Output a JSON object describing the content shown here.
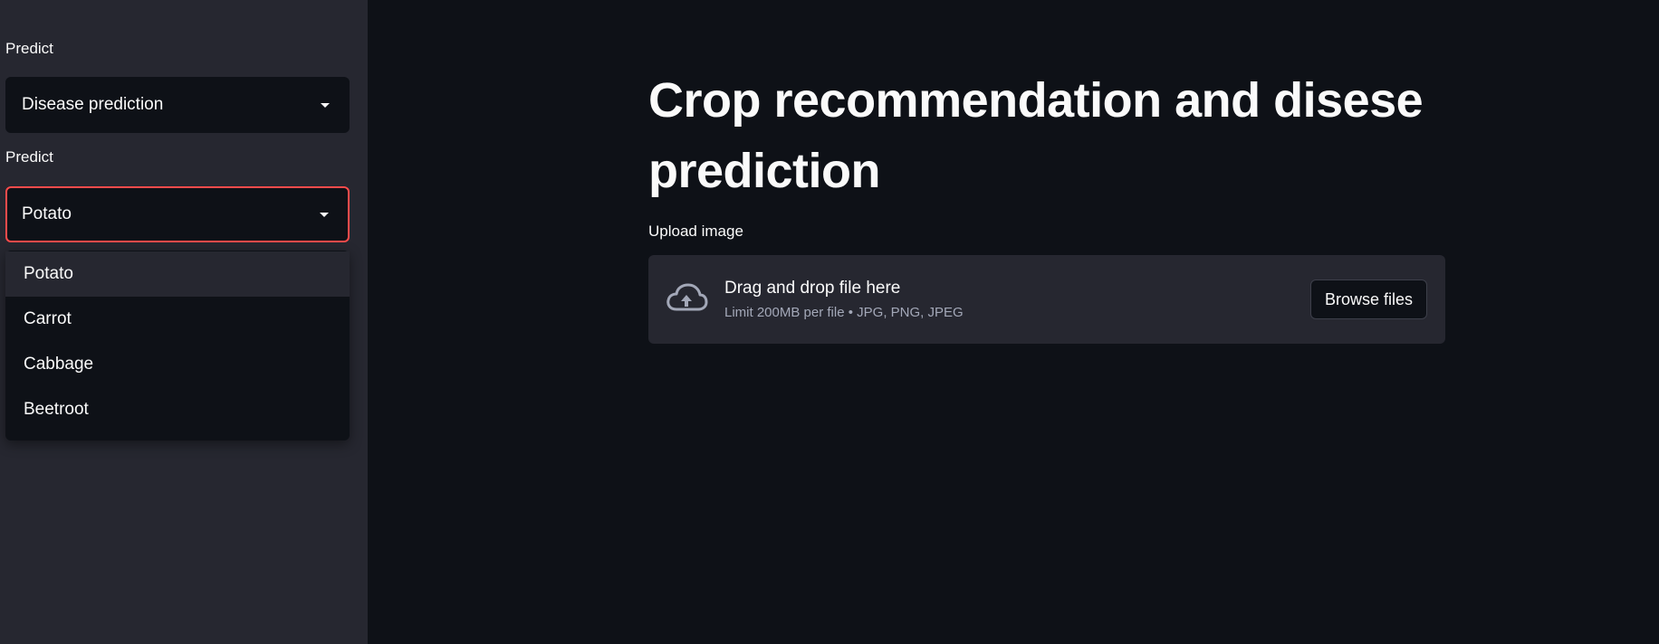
{
  "sidebar": {
    "select_1": {
      "label": "Predict",
      "value": "Disease prediction"
    },
    "select_2": {
      "label": "Predict",
      "value": "Potato",
      "options": [
        "Potato",
        "Carrot",
        "Cabbage",
        "Beetroot"
      ]
    }
  },
  "main": {
    "title": "Crop recommendation and disese prediction",
    "uploader": {
      "label": "Upload image",
      "instruction": "Drag and drop file here",
      "limits": "Limit 200MB per file • JPG, PNG, JPEG",
      "browse_label": "Browse files"
    }
  },
  "colors": {
    "sidebar_bg": "#262730",
    "main_bg": "#0e1117",
    "accent": "#ff4b4b",
    "text": "#fafafa",
    "muted_text": "#a3a8b8"
  },
  "icons": {
    "upload": "cloud-upload-icon",
    "caret": "caret-down-icon"
  }
}
